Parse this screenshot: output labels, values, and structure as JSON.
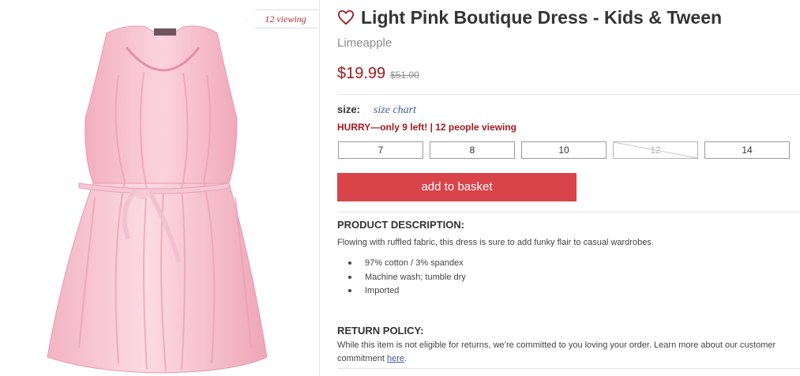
{
  "image_panel": {
    "viewing_badge": "12 viewing",
    "image_alt": "pink ruffled sleeveless dress with sash"
  },
  "product": {
    "title": "Light Pink Boutique Dress - Kids & Tween",
    "brand": "Limeapple",
    "price": "$19.99",
    "original_price": "$51.00",
    "favorite_icon": "heart-outline-icon"
  },
  "size_selector": {
    "label": "size:",
    "chart_link": "size chart",
    "urgency": "HURRY—only 9 left! | 12 people viewing",
    "options": [
      {
        "label": "7",
        "available": true
      },
      {
        "label": "8",
        "available": true
      },
      {
        "label": "10",
        "available": true
      },
      {
        "label": "12",
        "available": false
      },
      {
        "label": "14",
        "available": true
      }
    ]
  },
  "cart": {
    "add_label": "add to basket"
  },
  "description": {
    "heading": "PRODUCT DESCRIPTION:",
    "text": "Flowing with ruffled fabric, this dress is sure to add funky flair to casual wardrobes.",
    "features": [
      "97% cotton / 3% spandex",
      "Machine wash; tumble dry",
      "Imported"
    ]
  },
  "return_policy": {
    "heading": "RETURN POLICY:",
    "text": "While this item is not eligible for returns, we’re committed to you loving your order. Learn more about our customer commitment ",
    "link": "here",
    "tail": "."
  },
  "colors": {
    "accent": "#d9434a",
    "price_red": "#a3191f",
    "dress_pink": "#f4b8c6",
    "link_blue": "#3e5f9c"
  }
}
